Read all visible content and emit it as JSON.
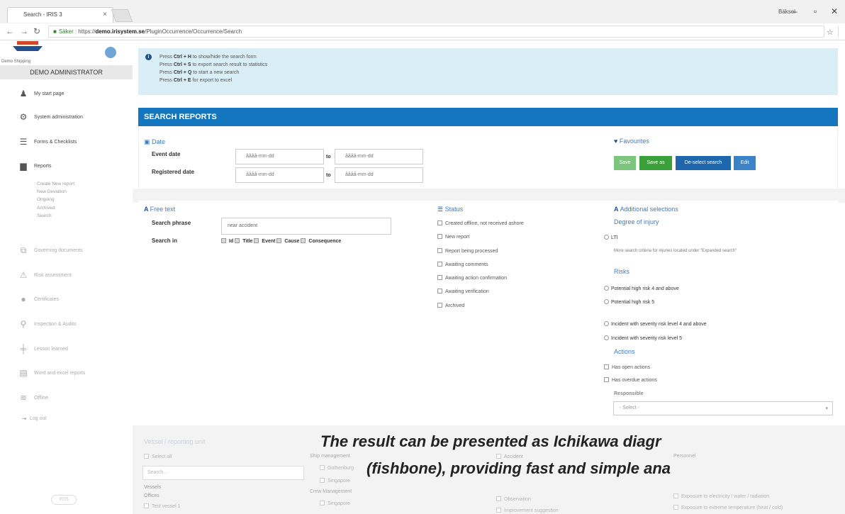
{
  "browser": {
    "tab_title": "Search - IRIS 3",
    "window_user": "Bäksel",
    "secure_label": "Säker",
    "url_prefix": "https://",
    "url_host": "demo.irisystem.se",
    "url_path": "/PluginOccurrence/Occurrence/Search"
  },
  "sidebar": {
    "logo_text": "Demo Shipping",
    "user": "DEMO ADMINISTRATOR",
    "items": [
      {
        "label": "My start page",
        "icon": "person-icon"
      },
      {
        "label": "System administration",
        "icon": "gear-icon"
      },
      {
        "label": "Forms & Checklists",
        "icon": "list-icon"
      },
      {
        "label": "Reports",
        "icon": "book-icon"
      },
      {
        "label": "Governing documents",
        "icon": "documents-icon"
      },
      {
        "label": "Risk assessment",
        "icon": "warning-icon"
      },
      {
        "label": "Certificates",
        "icon": "certificate-icon"
      },
      {
        "label": "Inspection & Audits",
        "icon": "magnifier-icon"
      },
      {
        "label": "Lesson learned",
        "icon": "lesson-icon"
      },
      {
        "label": "Word and excel reports",
        "icon": "file-icon"
      },
      {
        "label": "Offline",
        "icon": "wifi-icon"
      },
      {
        "label": "Log out",
        "icon": "logout-icon"
      }
    ],
    "report_subitems": [
      "Create New report",
      "New Deviation",
      "Ongoing",
      "Archived",
      "Search"
    ],
    "footer_logo": "IRIS"
  },
  "info": {
    "lines": [
      {
        "pre": "Press ",
        "key": "Ctrl + H",
        "post": " to show/hide the search form"
      },
      {
        "pre": "Press ",
        "key": "Ctrl + S",
        "post": " to export search result to statistics"
      },
      {
        "pre": "Press ",
        "key": "Ctrl + Q",
        "post": " to start a new search"
      },
      {
        "pre": "Press ",
        "key": "Ctrl + E",
        "post": " for export to excel"
      }
    ]
  },
  "search": {
    "header": "SEARCH REPORTS",
    "date_title": "Date",
    "event_date_label": "Event date",
    "registered_date_label": "Registered date",
    "date_placeholder": "åååå-mm-dd",
    "to": "to",
    "favourites_title": "Favourites",
    "buttons": {
      "save": "Save",
      "save_as": "Save as",
      "deselect": "De-select search",
      "edit": "Edit"
    },
    "free_text_title": "Free text",
    "search_phrase_label": "Search phrase",
    "search_phrase_value": "near accident",
    "search_in_label": "Search in",
    "search_in_options": [
      "Id",
      "Title",
      "Event",
      "Cause",
      "Consequence"
    ],
    "status_title": "Status",
    "status_options": [
      "Created offline, not received ashore",
      "New report",
      "Report being processed",
      "Awaiting comments",
      "Awaiting action confirmation",
      "Awaiting verification",
      "Archived"
    ],
    "additional_title": "Additional selections",
    "degree_of_injury": "Degree of injury",
    "lti": "LTI",
    "injury_note": "More search criteria for injuries located under \"Expanded search\"",
    "risks_title": "Risks",
    "risk_options": [
      "Potential high risk 4 and above",
      "Potential high risk 5",
      "Incident with severity risk level 4 and above",
      "Incident with severity risk level 5"
    ],
    "actions_title": "Actions",
    "action_options": [
      "Has open actions",
      "Has overdue actions"
    ],
    "responsible_label": "Responsible",
    "responsible_value": "- Select -"
  },
  "lower": {
    "vessel_title": "Vessel / reporting unit",
    "select_all": "Select all",
    "search_placeholder": "Search...",
    "vessels": "Vessels",
    "offices": "Offices",
    "test_vessel": "Test vessel 1",
    "ship_management": "Ship management",
    "gothenburg": "Gothenburg",
    "singapore": "Singapore",
    "crew_management": "Crew Management",
    "crew_singapore": "Singapore",
    "accident": "Accident",
    "observation": "Observation",
    "improvement": "Improvement suggestion",
    "personnel": "Personnel",
    "exposure1": "Exposure to electricity / water / radiation",
    "exposure2": "Exposure to extreme temperature (heat / cold)"
  },
  "caption": {
    "line1": "The result can be presented as Ichikawa diagr",
    "line2": "(fishbone), providing fast and simple ana"
  },
  "colors": {
    "header_blue": "#1376bf",
    "info_bg": "#d9eef7",
    "save_green": "#7cc57c",
    "save_as_green": "#3aa13a",
    "deselect_blue": "#1f67ad",
    "edit_blue": "#3c82c6"
  }
}
